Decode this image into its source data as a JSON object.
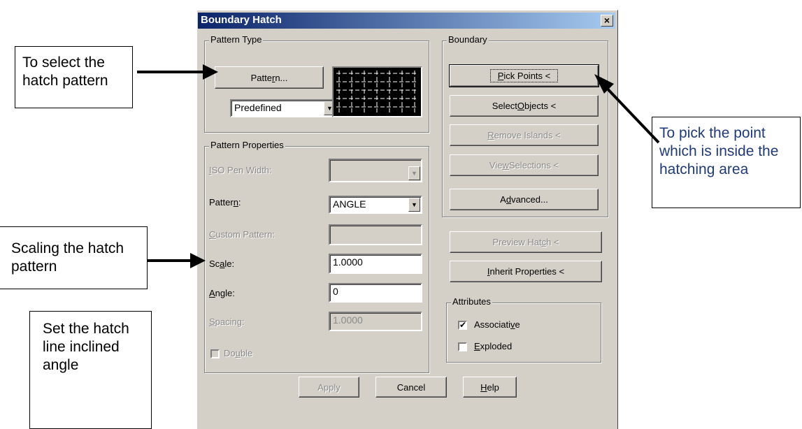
{
  "window": {
    "title": "Boundary Hatch",
    "close_glyph": "×"
  },
  "pattern_type": {
    "group_label": "Pattern Type",
    "pattern_button_pre": "Patte",
    "pattern_button_u": "r",
    "pattern_button_post": "n...",
    "predefined_value": "Predefined",
    "preview_icon": "hatch-grid-preview"
  },
  "pattern_properties": {
    "group_label": "Pattern Properties",
    "iso_pen_width_pre": "",
    "iso_pen_width_u": "I",
    "iso_pen_width_post": "SO Pen Width:",
    "pattern_label_pre": "Patter",
    "pattern_label_u": "n",
    "pattern_label_post": ":",
    "pattern_value": "ANGLE",
    "custom_pattern_pre": "",
    "custom_pattern_u": "C",
    "custom_pattern_post": "ustom Pattern:",
    "scale_label_pre": "Sc",
    "scale_label_u": "a",
    "scale_label_post": "le:",
    "scale_value": "1.0000",
    "angle_label_pre": "",
    "angle_label_u": "A",
    "angle_label_post": "ngle:",
    "angle_value": "0",
    "spacing_label_pre": "",
    "spacing_label_u": "S",
    "spacing_label_post": "pacing:",
    "spacing_value": "1.0000",
    "double_label_pre": "Do",
    "double_label_u": "u",
    "double_label_post": "ble"
  },
  "boundary": {
    "group_label": "Boundary",
    "pick_points_pre": "",
    "pick_points_u": "P",
    "pick_points_post": "ick Points <",
    "select_objects_pre": "Select ",
    "select_objects_u": "O",
    "select_objects_post": "bjects <",
    "remove_islands_pre": "",
    "remove_islands_u": "R",
    "remove_islands_post": "emove Islands <",
    "view_selections_pre": "Vie",
    "view_selections_u": "w",
    "view_selections_post": " Selections <",
    "advanced_pre": "A",
    "advanced_u": "d",
    "advanced_post": "vanced..."
  },
  "right_buttons": {
    "preview_hatch_pre": "Preview Hat",
    "preview_hatch_u": "c",
    "preview_hatch_post": "h <",
    "inherit_pre": "",
    "inherit_u": "I",
    "inherit_post": "nherit Properties <"
  },
  "attributes": {
    "group_label": "Attributes",
    "associative_pre": "Associati",
    "associative_u": "v",
    "associative_post": "e",
    "associative_checked": "✔",
    "exploded_pre": "",
    "exploded_u": "E",
    "exploded_post": "xploded"
  },
  "footer": {
    "apply_label": "Apply",
    "cancel_label": "Cancel",
    "help_pre": "",
    "help_u": "H",
    "help_post": "elp"
  },
  "callouts": {
    "select_pattern": "To select the hatch pattern",
    "pick_point": "To pick the point which is inside the hatching area",
    "scaling": "Scaling the hatch pattern",
    "angle": "Set the hatch line inclined angle"
  }
}
